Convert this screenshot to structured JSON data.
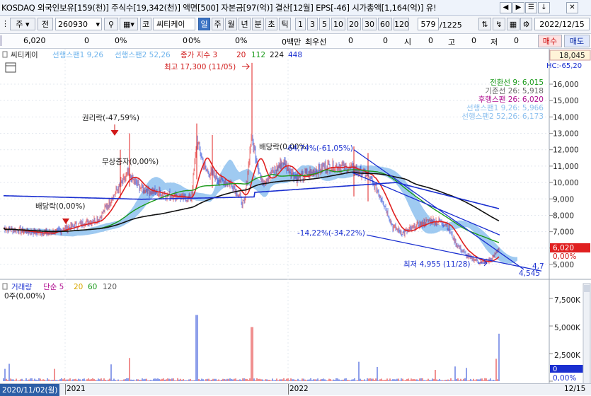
{
  "title": {
    "text": "KOSDAQ 외국인보유[159(천)] 주식수[19,342(천)] 액면[500] 자본금[97(억)] 결산[12월] EPS[-46] 시가총액[1,164(억)] 유!",
    "buttons": [
      "◀",
      "▶",
      "☰",
      "↓",
      "✕"
    ]
  },
  "toolbar": {
    "market": "주",
    "market2": "전",
    "code": "260930",
    "name_prefix": "코",
    "stock_name": "씨티케이",
    "periods": [
      "일",
      "주",
      "월",
      "년",
      "분",
      "초",
      "틱"
    ],
    "intervals": [
      "1",
      "3",
      "5",
      "10",
      "20",
      "30",
      "60",
      "120"
    ],
    "count": "579",
    "count_total": "/1225",
    "date": "2022/12/15"
  },
  "quote": {
    "price": "6,020",
    "v1": "0",
    "v2": "0%",
    "v3": "0",
    "v4": "0%",
    "v5": "0",
    "v6": "0%",
    "unit": "0백만",
    "lbl_choi": "최우선",
    "v7": "0",
    "v8": "0",
    "lbl_si": "시",
    "v9": "0",
    "lbl_go": "고",
    "v10": "0",
    "lbl_jeo": "저",
    "v11": "0",
    "buy": "매수",
    "sell": "매도"
  },
  "legend": {
    "name": "씨티케이",
    "span1": "선행스팬1 9,26",
    "span2": "선행스팬2 52,26",
    "ma_label": "종가 지수 3",
    "ma20": "20",
    "ma112": "112",
    "ma224": "224",
    "ma448": "448",
    "right_price": "18,045",
    "right_hc": "HC:-65,20"
  },
  "ichimoku": {
    "line1": "전환선 9: 6,015",
    "line2": "기준선 26: 5,918",
    "line3": "후행스팬 26: 6,020",
    "line4": "선행스팬1 9,26: 5,966",
    "line5": "선행스팬2 52,26: 6,173"
  },
  "annotations": {
    "high": "최고 17,300 (11/05)",
    "rights": "권리락(-47,59%)",
    "bonus": "무상증자(0,00%)",
    "div1": "배당락(0,00%)",
    "div2": "배당락(0,00%)",
    "drop": "-64,74%(-61,05%)",
    "trend": "-14,22%(-34,22%)",
    "low": "최저 4,955 (11/28)",
    "target": "4,545",
    "target2": "4,7"
  },
  "price_axis": [
    "16,000",
    "15,000",
    "14,000",
    "13,000",
    "12,000",
    "11,000",
    "10,000",
    "9,000",
    "8,000",
    "7,000",
    "6,000",
    "5,000"
  ],
  "price_tag": "6,020",
  "pct_tag": "0,00%",
  "volume": {
    "label": "거래량",
    "ma_label": "단순 5",
    "ma20": "20",
    "ma60": "60",
    "ma120": "120",
    "value": "0주(0,00%)",
    "axis": [
      "7,500K",
      "5,000K",
      "2,500K"
    ],
    "bottom_tag": "0,00%",
    "zero_tag": "0"
  },
  "bottom": {
    "start_date": "2020/11/02(월)",
    "y2021": "2021",
    "y2022": "2022",
    "end": "12/15"
  },
  "colors": {
    "candle_up": "#e02020",
    "candle_down": "#1c3fd6",
    "cloud": "#8ec1ef",
    "ma20": "#e02020",
    "ma112": "#1a9a1a",
    "ma224": "#111111",
    "ma448": "#1a2fd0",
    "trend": "#1a2fd0"
  }
}
